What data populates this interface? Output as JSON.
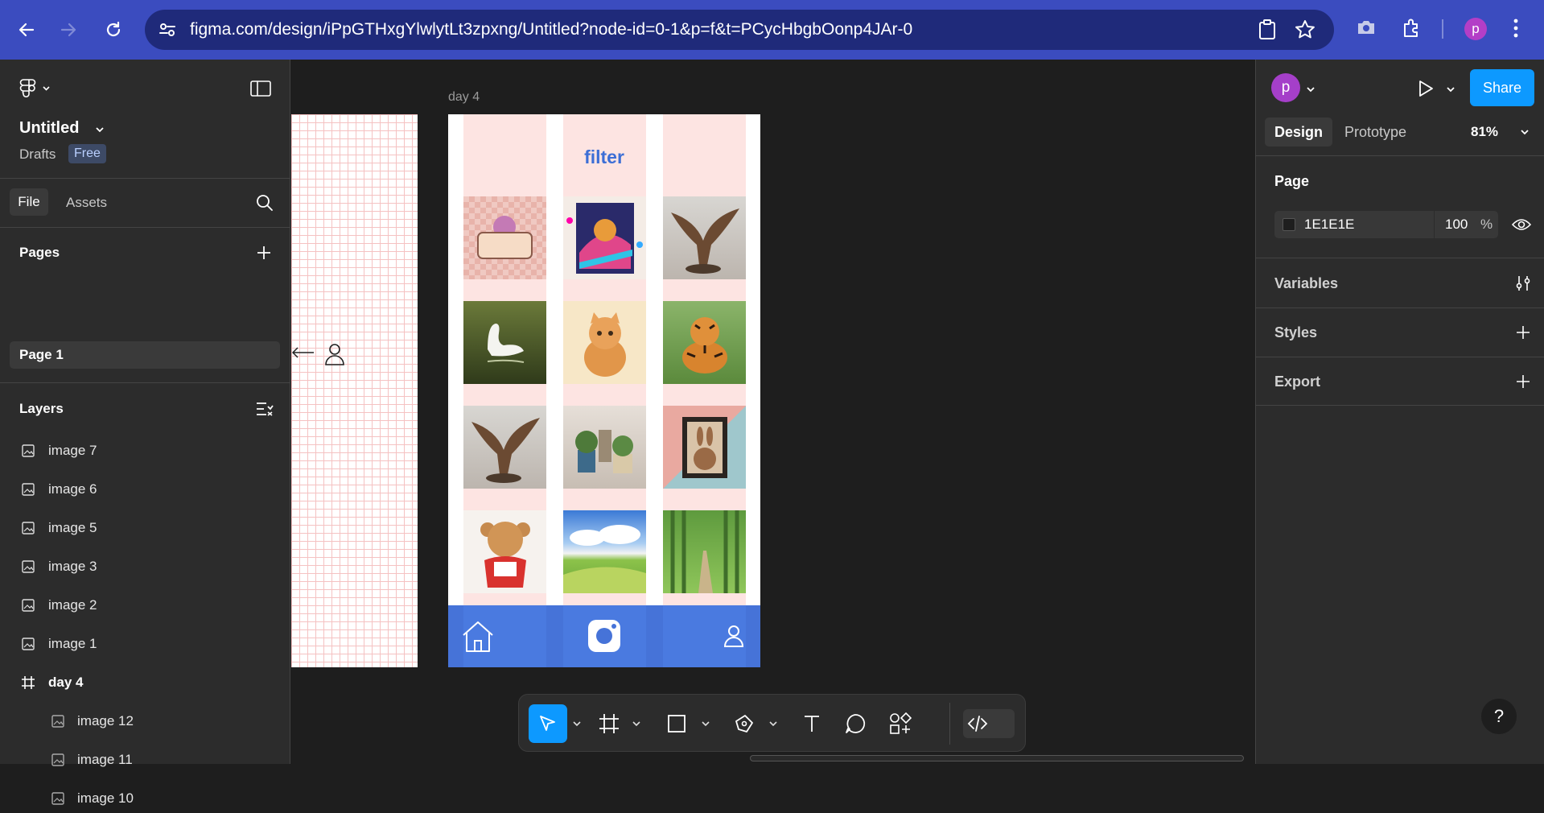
{
  "browser": {
    "url": "figma.com/design/iPpGTHxgYlwlytLt3zpxng/Untitled?node-id=0-1&p=f&t=PCycHbgbOonp4JAr-0",
    "profile_initial": "p",
    "icons": [
      "back-icon",
      "forward-icon",
      "reload-icon",
      "site-info-icon",
      "clipboard-icon",
      "star-icon",
      "camera-icon",
      "extensions-icon",
      "more-icon"
    ]
  },
  "left_panel": {
    "file_name": "Untitled",
    "location": "Drafts",
    "plan_badge": "Free",
    "tabs": {
      "file": "File",
      "assets": "Assets"
    },
    "pages_title": "Pages",
    "pages": [
      "Page 1"
    ],
    "layers_title": "Layers",
    "layers": [
      {
        "label": "image 7",
        "kind": "image",
        "indent": 0
      },
      {
        "label": "image 6",
        "kind": "image",
        "indent": 0
      },
      {
        "label": "image 5",
        "kind": "image",
        "indent": 0
      },
      {
        "label": "image 3",
        "kind": "image",
        "indent": 0
      },
      {
        "label": "image 2",
        "kind": "image",
        "indent": 0
      },
      {
        "label": "image 1",
        "kind": "image",
        "indent": 0
      },
      {
        "label": "day 4",
        "kind": "frame",
        "indent": 0
      },
      {
        "label": "image 12",
        "kind": "image",
        "indent": 1
      },
      {
        "label": "image 11",
        "kind": "image",
        "indent": 1
      },
      {
        "label": "image 10",
        "kind": "image",
        "indent": 1
      }
    ]
  },
  "canvas": {
    "frame_label": "day 4",
    "filter_title": "filter",
    "grid_images": [
      "cookie-sign",
      "cat-surfing-art",
      "eagle-statue",
      "swan",
      "kitten",
      "tiger",
      "eagle-statue",
      "potted-plants",
      "rabbit-frame",
      "teddy-bear",
      "green-fields",
      "bamboo-path"
    ],
    "bottom_nav_icons": [
      "home-icon",
      "instagram-icon",
      "profile-icon"
    ]
  },
  "toolbar": {
    "tools": [
      "move-tool",
      "frame-tool",
      "rectangle-tool",
      "pen-tool",
      "text-tool",
      "comment-tool",
      "actions-tool",
      "dev-mode-toggle"
    ]
  },
  "right_panel": {
    "avatar_initial": "p",
    "share_label": "Share",
    "tabs": {
      "design": "Design",
      "prototype": "Prototype"
    },
    "zoom": "81%",
    "page_section": "Page",
    "page_color": "1E1E1E",
    "page_opacity": "100",
    "opacity_unit": "%",
    "variables": "Variables",
    "styles": "Styles",
    "export": "Export",
    "help": "?"
  },
  "colors": {
    "browser_bar": "#3b4cbf",
    "figma_accent": "#0d99ff",
    "canvas_bg": "#1e1e1e",
    "panel_bg": "#2c2c2c",
    "phone_bar": "#4673d8",
    "filter_text": "#3c6ed6"
  }
}
